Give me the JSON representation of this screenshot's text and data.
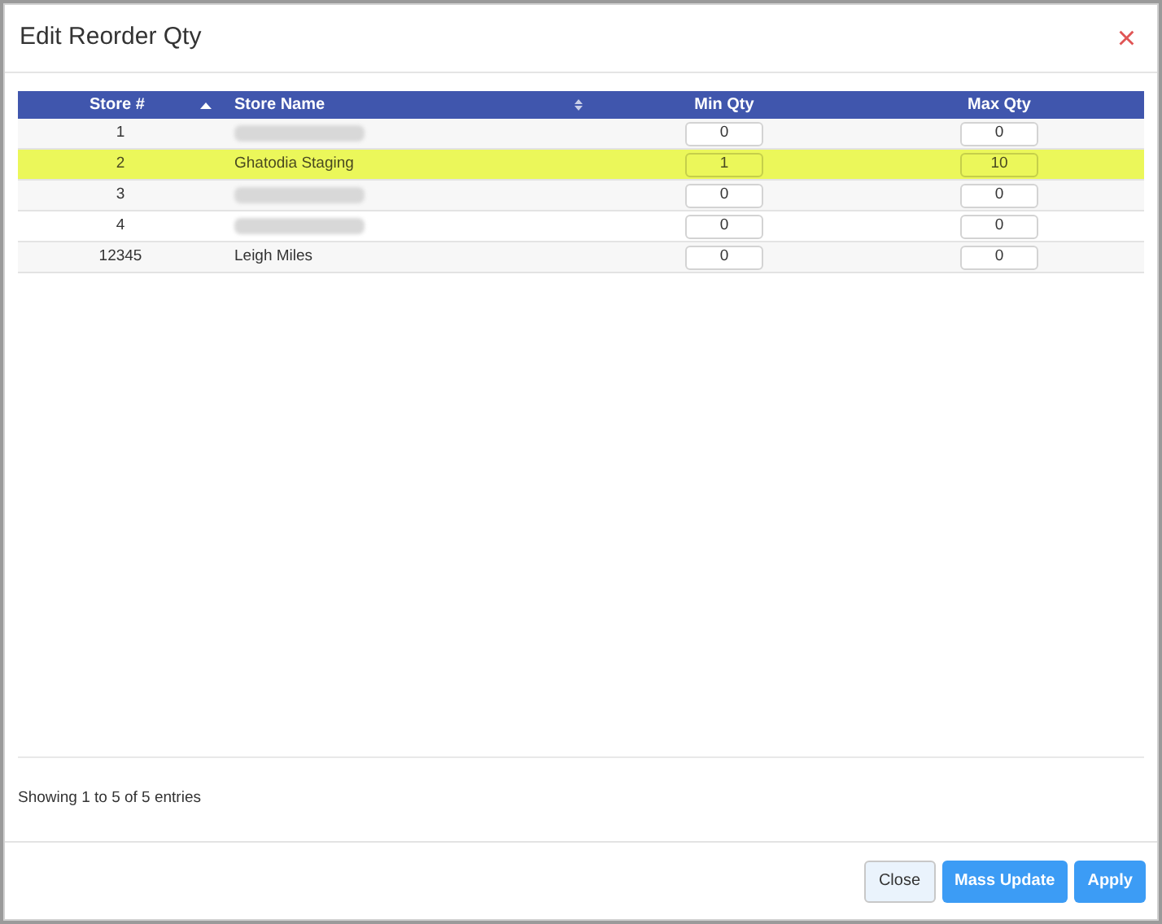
{
  "dialog": {
    "title": "Edit Reorder Qty",
    "close_icon": "×"
  },
  "table": {
    "columns": [
      {
        "label": "Store #",
        "kind": "ascending"
      },
      {
        "label": "Store Name",
        "kind": "sortable"
      },
      {
        "label": "Min Qty",
        "kind": "plain"
      },
      {
        "label": "Max Qty",
        "kind": "plain"
      }
    ],
    "rows": [
      {
        "store": "1",
        "kind": "blurred",
        "min": "0",
        "max": "0",
        "selected": false
      },
      {
        "store": "2",
        "kind": "named",
        "name": "Ghatodia Staging",
        "min": "1",
        "max": "10",
        "selected": true
      },
      {
        "store": "3",
        "kind": "blurred",
        "min": "0",
        "max": "0",
        "selected": false
      },
      {
        "store": "4",
        "kind": "blurred",
        "min": "0",
        "max": "0",
        "selected": false
      },
      {
        "store": "12345",
        "kind": "named",
        "name": "Leigh Miles",
        "min": "0",
        "max": "0",
        "selected": false
      }
    ]
  },
  "info": "Showing 1 to 5 of 5 entries",
  "buttons": [
    {
      "label": "Close",
      "kind": "secondary"
    },
    {
      "label": "Mass Update",
      "kind": "primary"
    },
    {
      "label": "Apply",
      "kind": "primary"
    }
  ]
}
